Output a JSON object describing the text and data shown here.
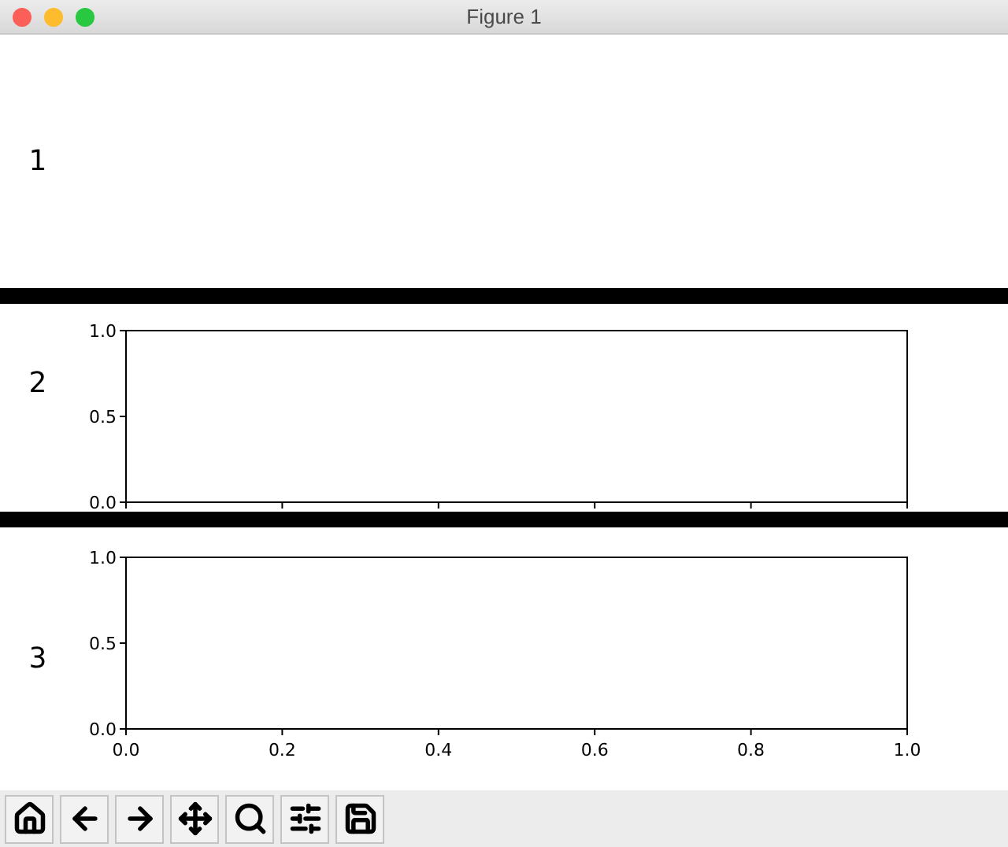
{
  "window": {
    "title": "Figure 1"
  },
  "panels": [
    {
      "label": "1"
    },
    {
      "label": "2",
      "chart_data": {
        "type": "line",
        "xlim": [
          0,
          1
        ],
        "ylim": [
          0,
          1
        ],
        "yticks": [
          {
            "value": 0,
            "label": "0.0"
          },
          {
            "value": 0.5,
            "label": "0.5"
          },
          {
            "value": 1,
            "label": "1.0"
          }
        ]
      }
    },
    {
      "label": "3",
      "chart_data": {
        "type": "line",
        "xlim": [
          0,
          1
        ],
        "ylim": [
          0,
          1
        ],
        "xticks": [
          {
            "value": 0,
            "label": "0.0"
          },
          {
            "value": 0.2,
            "label": "0.2"
          },
          {
            "value": 0.4,
            "label": "0.4"
          },
          {
            "value": 0.6,
            "label": "0.6"
          },
          {
            "value": 0.8,
            "label": "0.8"
          },
          {
            "value": 1,
            "label": "1.0"
          }
        ],
        "yticks": [
          {
            "value": 0,
            "label": "0.0"
          },
          {
            "value": 0.5,
            "label": "0.5"
          },
          {
            "value": 1,
            "label": "1.0"
          }
        ]
      }
    }
  ],
  "toolbar": {
    "buttons": [
      {
        "kind": "home"
      },
      {
        "kind": "back"
      },
      {
        "kind": "forward"
      },
      {
        "kind": "pan"
      },
      {
        "kind": "zoom"
      },
      {
        "kind": "configure"
      },
      {
        "kind": "save"
      }
    ]
  }
}
